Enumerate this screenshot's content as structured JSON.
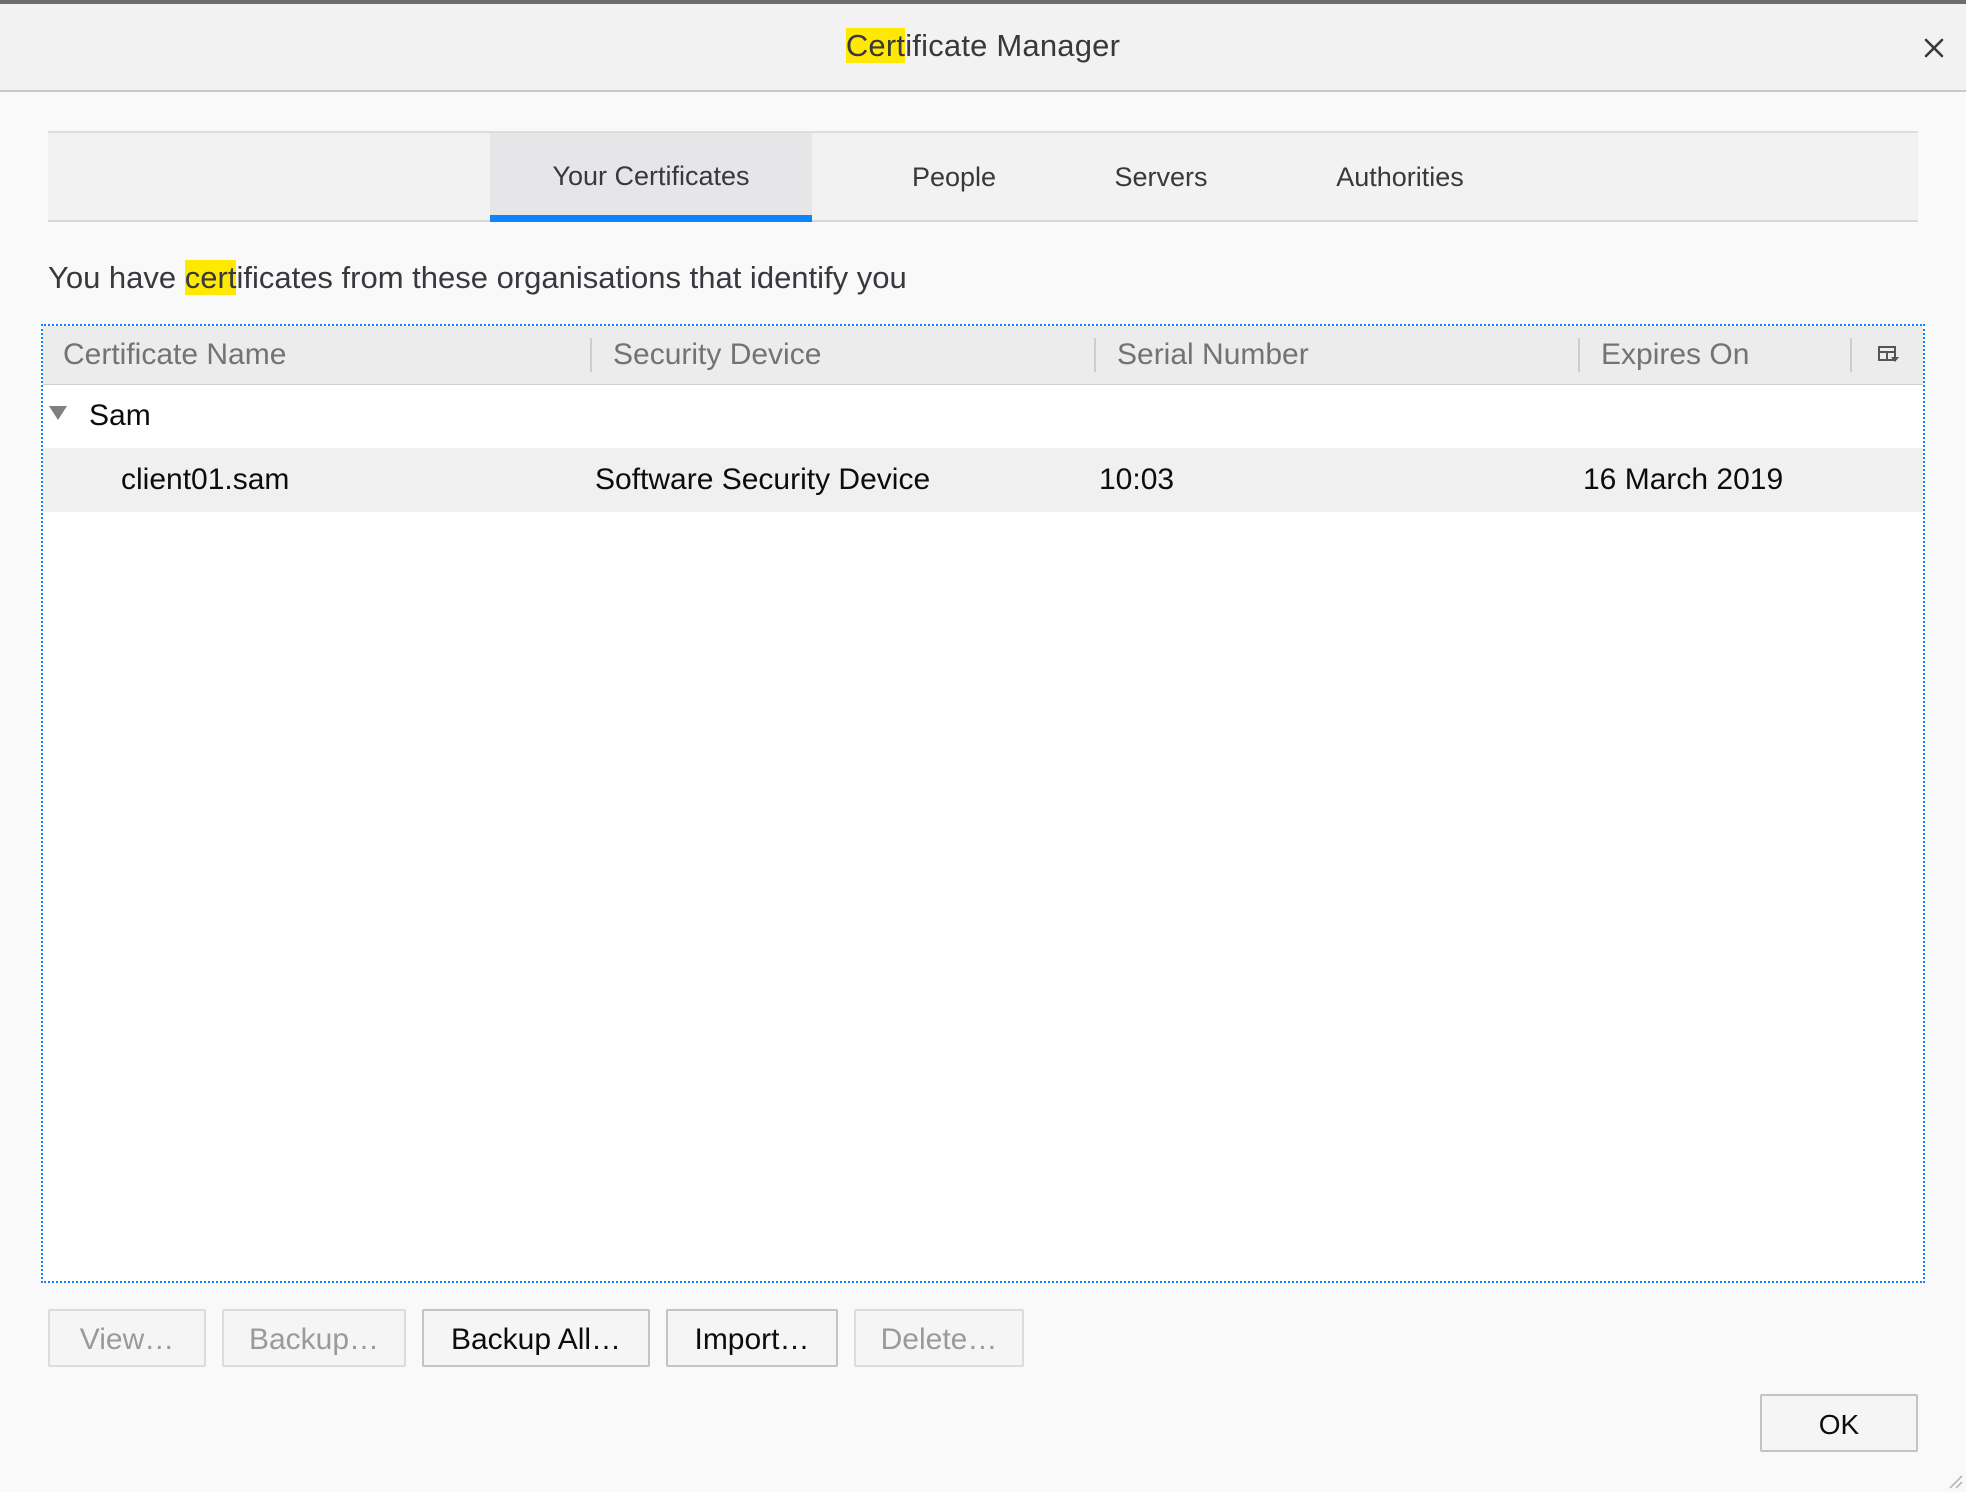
{
  "window": {
    "title_highlight": "Cert",
    "title_rest": "ificate Manager",
    "close_icon": "close-icon"
  },
  "tabs": [
    {
      "label": "Your Certificates",
      "selected": true
    },
    {
      "label": "People",
      "selected": false
    },
    {
      "label": "Servers",
      "selected": false
    },
    {
      "label": "Authorities",
      "selected": false
    }
  ],
  "intro": {
    "before": "You have ",
    "highlight": "cert",
    "after": "ificates from these organisations that identify you"
  },
  "table": {
    "columns": [
      "Certificate Name",
      "Security Device",
      "Serial Number",
      "Expires On"
    ],
    "column_picker_icon": "column-picker-icon",
    "groups": [
      {
        "name": "Sam",
        "expanded": true,
        "rows": [
          {
            "certificate_name": "client01.sam",
            "security_device": "Software Security Device",
            "serial_number": "10:03",
            "expires_on": "16 March 2019"
          }
        ]
      }
    ]
  },
  "buttons": {
    "view": "View…",
    "backup": "Backup…",
    "backup_all": "Backup All…",
    "import": "Import…",
    "delete": "Delete…",
    "ok": "OK"
  },
  "colors": {
    "accent": "#0a84ff",
    "highlight": "#ffe900"
  }
}
